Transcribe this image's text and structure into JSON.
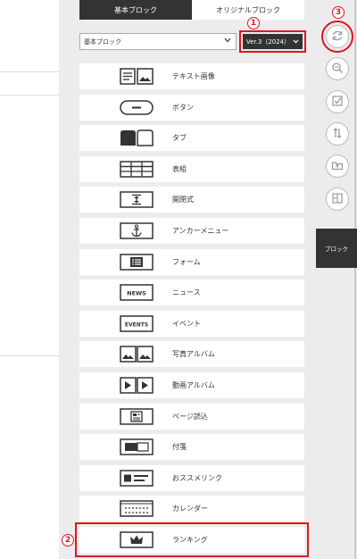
{
  "tabs": {
    "basic": "基本ブロック",
    "original": "オリジナルブロック"
  },
  "preset_select": {
    "value": "基本ブロック"
  },
  "version_select": {
    "value": "Ver.3（2024）"
  },
  "markers": {
    "one": "1",
    "two": "2",
    "three": "3"
  },
  "blocks": [
    {
      "label": "テキスト画像",
      "icon": "text-image-icon"
    },
    {
      "label": "ボタン",
      "icon": "button-icon"
    },
    {
      "label": "タブ",
      "icon": "tab-icon"
    },
    {
      "label": "表組",
      "icon": "table-icon"
    },
    {
      "label": "開閉式",
      "icon": "accordion-icon"
    },
    {
      "label": "アンカーメニュー",
      "icon": "anchor-icon"
    },
    {
      "label": "フォーム",
      "icon": "form-icon"
    },
    {
      "label": "ニュース",
      "icon": "news-icon",
      "icon_text": "NEWS"
    },
    {
      "label": "イベント",
      "icon": "events-icon",
      "icon_text": "EVENTS"
    },
    {
      "label": "写真アルバム",
      "icon": "photo-album-icon"
    },
    {
      "label": "動画アルバム",
      "icon": "video-album-icon"
    },
    {
      "label": "ページ読込",
      "icon": "page-load-icon"
    },
    {
      "label": "付箋",
      "icon": "sticky-note-icon"
    },
    {
      "label": "おススメリンク",
      "icon": "recommend-link-icon"
    },
    {
      "label": "カレンダー",
      "icon": "calendar-icon"
    },
    {
      "label": "ランキング",
      "icon": "crown-icon"
    }
  ],
  "toolbar": {
    "side_tab": "ブロック",
    "tools": [
      "refresh-icon",
      "zoom-icon",
      "checklist-icon",
      "sort-icon",
      "folder-icon",
      "layout-icon"
    ]
  },
  "colors": {
    "highlight": "#e0141e",
    "dark": "#333333",
    "panel": "#ececec"
  }
}
